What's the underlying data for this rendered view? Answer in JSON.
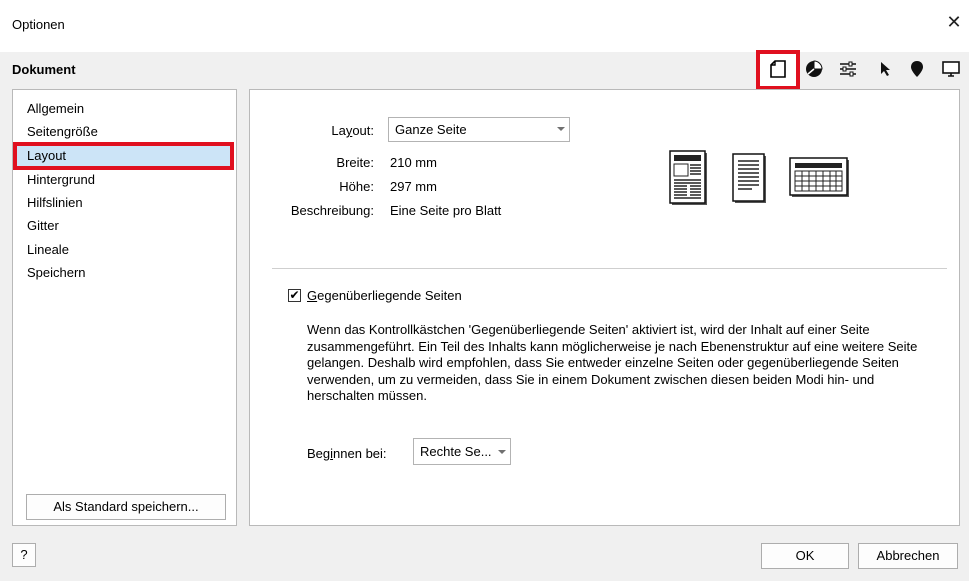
{
  "window": {
    "title": "Optionen",
    "close_glyph": "✕"
  },
  "section": {
    "title": "Dokument"
  },
  "toolbar": {
    "icons": [
      "page-icon",
      "color-wheel-icon",
      "sliders-icon",
      "pointer-icon",
      "pin-icon",
      "monitor-icon"
    ]
  },
  "sidebar": {
    "items": [
      {
        "label": "Allgemein"
      },
      {
        "label": "Seitengröße"
      },
      {
        "label": "Layout",
        "selected": true
      },
      {
        "label": "Hintergrund"
      },
      {
        "label": "Hilfslinien"
      },
      {
        "label": "Gitter"
      },
      {
        "label": "Lineale"
      },
      {
        "label": "Speichern"
      }
    ],
    "save_default_label": "Als Standard speichern..."
  },
  "layout_panel": {
    "layout_label_pre": "La",
    "layout_label_u": "y",
    "layout_label_post": "out:",
    "layout_value": "Ganze Seite",
    "width_label": "Breite:",
    "width_value": "210 mm",
    "height_label": "Höhe:",
    "height_value": "297 mm",
    "desc_label": "Beschreibung:",
    "desc_value": "Eine Seite pro Blatt",
    "facing_checked": true,
    "facing_check_glyph": "✔",
    "facing_label_u": "G",
    "facing_label_rest": "egenüberliegende Seiten",
    "facing_description": "Wenn das Kontrollkästchen 'Gegenüberliegende Seiten' aktiviert ist, wird der Inhalt auf einer Seite zusammengeführt. Ein Teil des Inhalts kann möglicherweise je nach Ebenenstruktur auf eine weitere Seite gelangen. Deshalb wird empfohlen, dass Sie entweder einzelne Seiten oder gegenüberliegende Seiten verwenden, um zu vermeiden, dass Sie in einem Dokument zwischen diesen beiden Modi hin- und herschalten müssen.",
    "start_label_pre": "Beg",
    "start_label_u": "i",
    "start_label_post": "nnen bei:",
    "start_value": "Rechte Se..."
  },
  "buttons": {
    "help": "?",
    "ok": "OK",
    "cancel": "Abbrechen"
  },
  "colors": {
    "highlight": "#e0101f",
    "selection": "#cce4f7"
  }
}
